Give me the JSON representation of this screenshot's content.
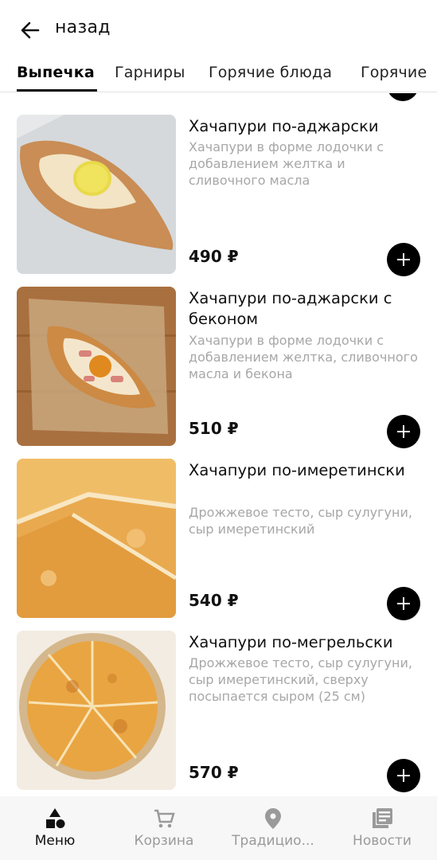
{
  "header": {
    "back_label": "назад"
  },
  "tabs": [
    {
      "label": "Выпечка"
    },
    {
      "label": "Гарниры"
    },
    {
      "label": "Горячие блюда"
    },
    {
      "label": "Горячие"
    }
  ],
  "items": [
    {
      "title": "Хачапури по-аджарски",
      "description": "Хачапури в форме лодочки с добавлением желтка и сливочного масла",
      "price": "490 ₽"
    },
    {
      "title": "Хачапури по-аджарски с беконом",
      "description": "Хачапури в форме лодочки с добавлением желтка, сливочного масла и бекона",
      "price": "510 ₽"
    },
    {
      "title": "Хачапури по-имеретински",
      "description": "Дрожжевое тесто, сыр сулугуни, сыр имеретинский",
      "price": "540 ₽"
    },
    {
      "title": "Хачапури по-мегрельски",
      "description": "Дрожжевое тесто, сыр сулугуни, сыр имеретинский, сверху посыпается сыром (25 см)",
      "price": "570 ₽"
    }
  ],
  "bottom_nav": [
    {
      "label": "Меню",
      "icon": "shapes-icon"
    },
    {
      "label": "Корзина",
      "icon": "cart-icon"
    },
    {
      "label": "Традицио...",
      "icon": "location-pin-icon"
    },
    {
      "label": "Новости",
      "icon": "news-icon"
    }
  ],
  "colors": {
    "accent": "#000000",
    "muted_text": "#a7a7a7",
    "nav_bg": "#f7f7f7"
  }
}
